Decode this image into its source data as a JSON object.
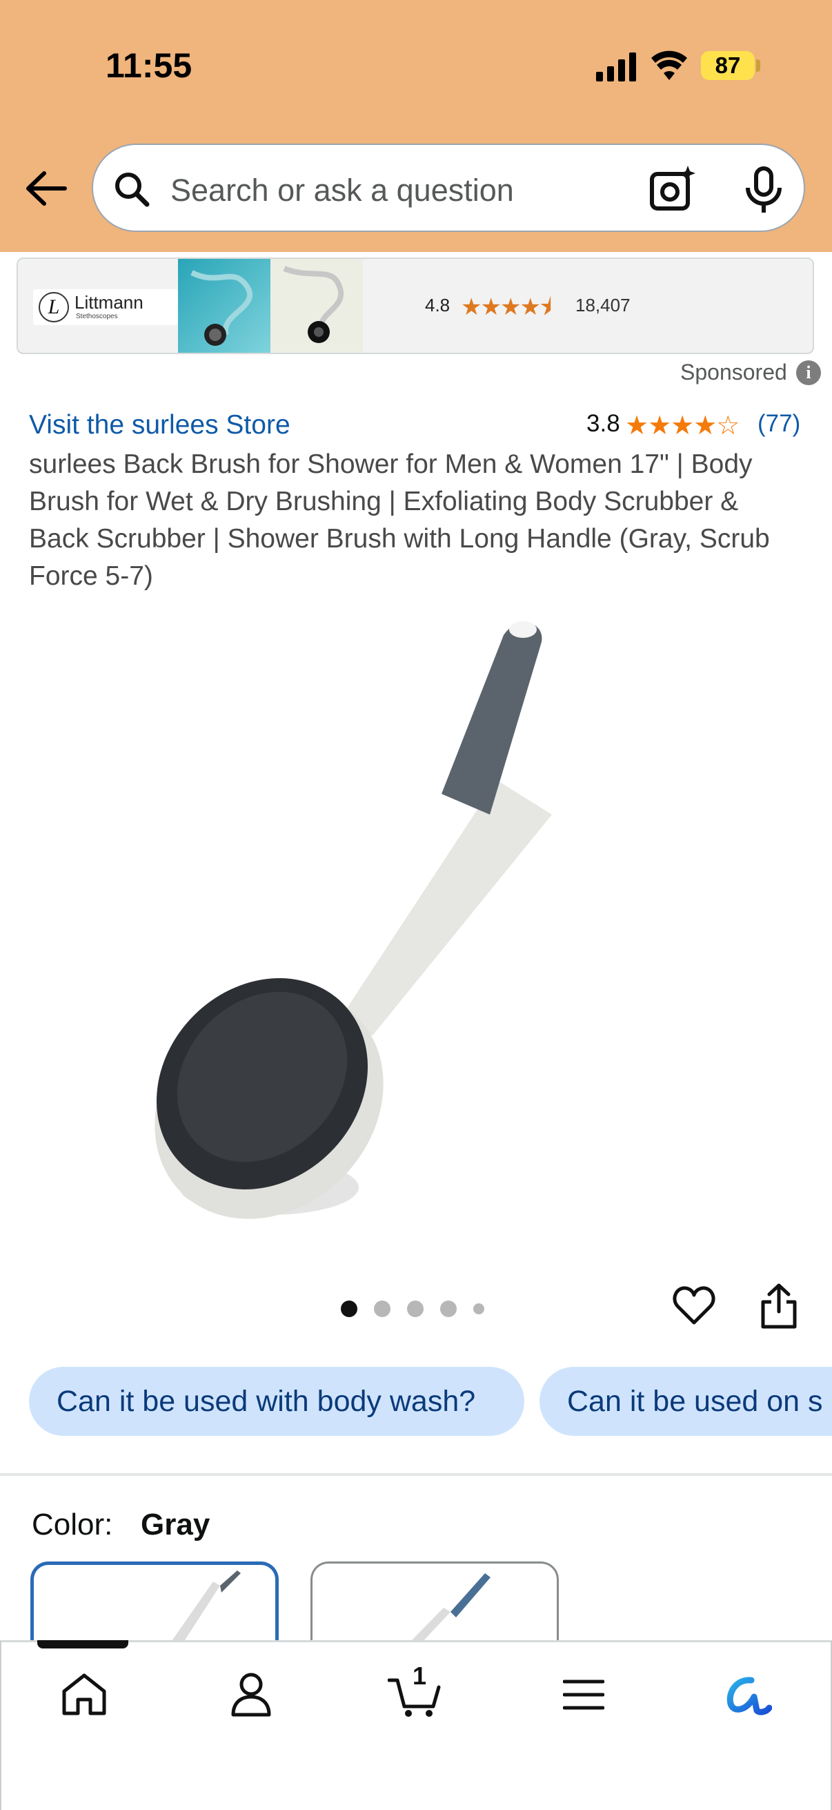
{
  "status_bar": {
    "time": "11:55",
    "battery": "87"
  },
  "search": {
    "placeholder": "Search or ask a question"
  },
  "ad": {
    "brand": "Littmann",
    "brand_sub": "Stethoscopes",
    "rating": "4.8",
    "stars": "★★★★⯨",
    "count": "18,407"
  },
  "sponsored_label": "Sponsored",
  "product": {
    "store_link": "Visit the surlees Store",
    "rating": "3.8",
    "stars": "★★★★☆",
    "rating_count": "(77)",
    "title": "surlees Back Brush for Shower for Men & Women 17\" | Body Brush for Wet & Dry Brushing | Exfoliating Body Scrubber & Back Scrubber | Shower Brush with Long Handle (Gray, Scrub Force 5-7)"
  },
  "carousel": {
    "total_dots": 5,
    "active_index": 0
  },
  "questions": [
    "Can it be used with body wash?",
    "Can it be used on s"
  ],
  "color": {
    "label": "Color:",
    "value": "Gray"
  },
  "nav": {
    "items": [
      "home-icon",
      "account-icon",
      "cart-icon",
      "menu-icon",
      "rufus-icon"
    ],
    "cart_count": "1"
  },
  "colors": {
    "header_bg": "#f0b47d",
    "link": "#0f5aa7",
    "star": "#f47b0a",
    "chip_bg": "#cfe4fc"
  }
}
